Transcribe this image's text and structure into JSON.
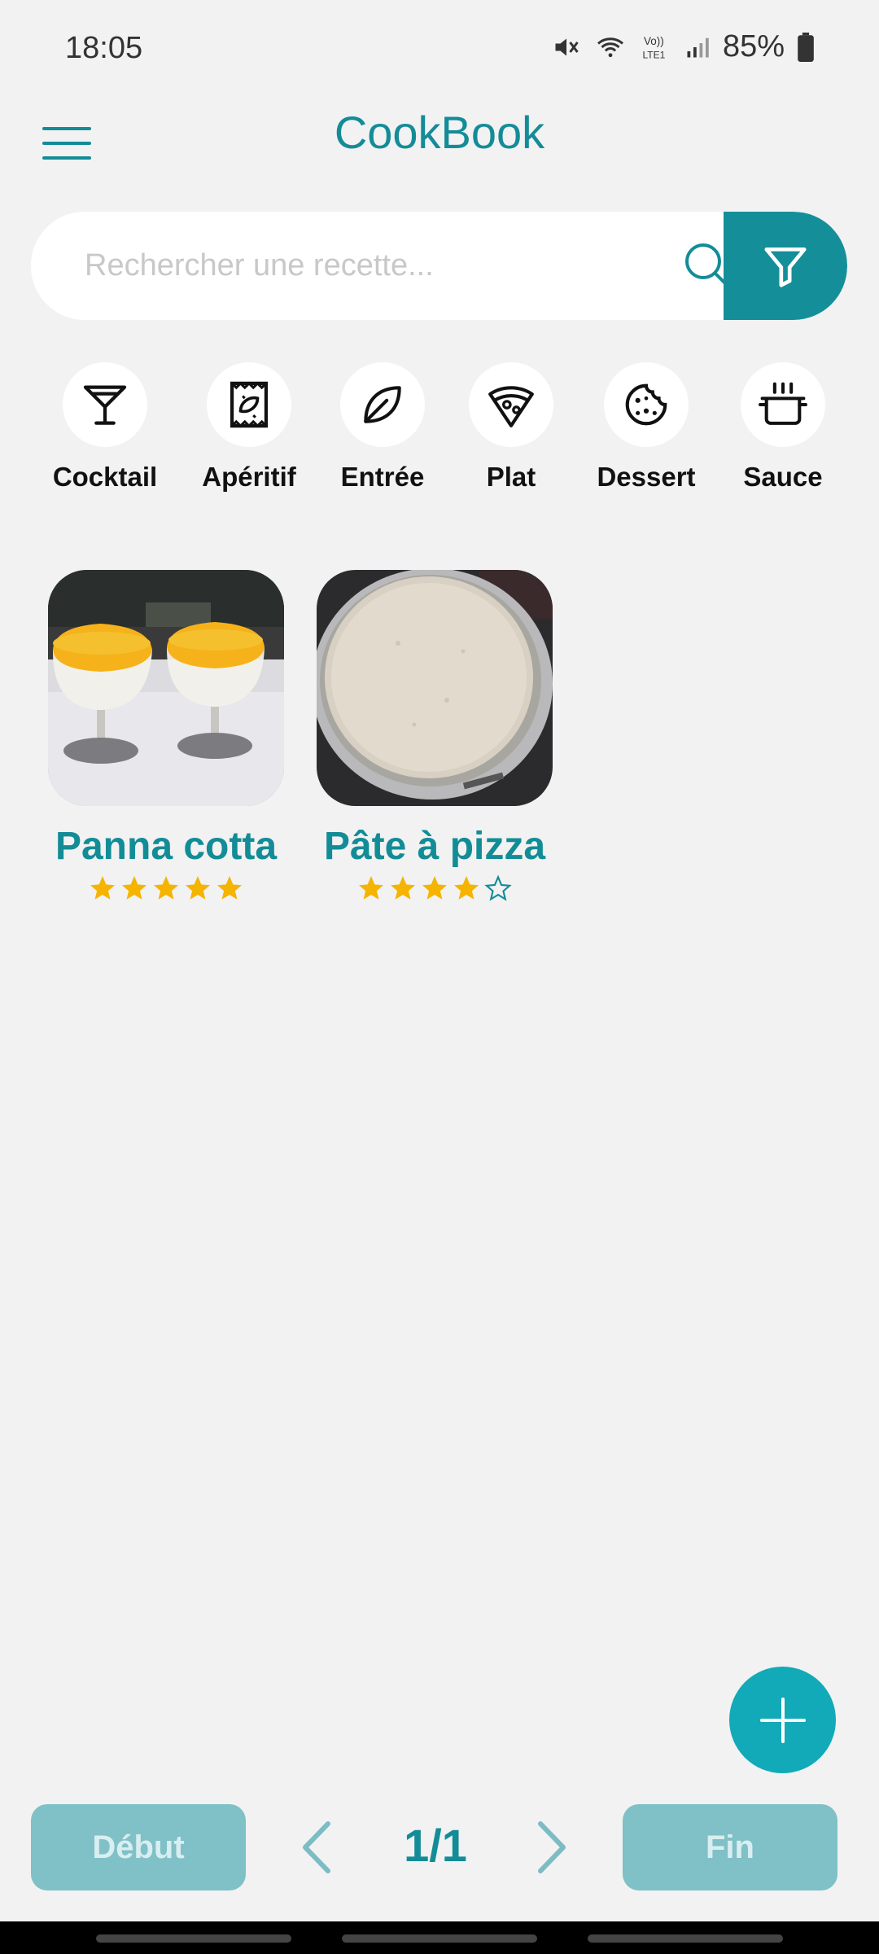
{
  "status_bar": {
    "time": "18:05",
    "battery": "85%"
  },
  "header": {
    "title": "CookBook"
  },
  "search": {
    "placeholder": "Rechercher une recette..."
  },
  "categories": [
    {
      "label": "Cocktail",
      "icon": "cocktail-glass-icon"
    },
    {
      "label": "Apéritif",
      "icon": "chips-bag-icon"
    },
    {
      "label": "Entrée",
      "icon": "leaf-icon"
    },
    {
      "label": "Plat",
      "icon": "pizza-slice-icon"
    },
    {
      "label": "Dessert",
      "icon": "cookie-icon"
    },
    {
      "label": "Sauce",
      "icon": "cooking-pot-icon"
    }
  ],
  "recipes": [
    {
      "name": "Panna cotta",
      "rating": 5,
      "max_rating": 5
    },
    {
      "name": "Pâte à pizza",
      "rating": 4,
      "max_rating": 5
    }
  ],
  "pagination": {
    "first_label": "Début",
    "last_label": "Fin",
    "page": "1/1"
  },
  "colors": {
    "accent": "#138c98",
    "fab": "#12aab8",
    "star": "#f5b400",
    "pager_button": "#80c0c7"
  }
}
